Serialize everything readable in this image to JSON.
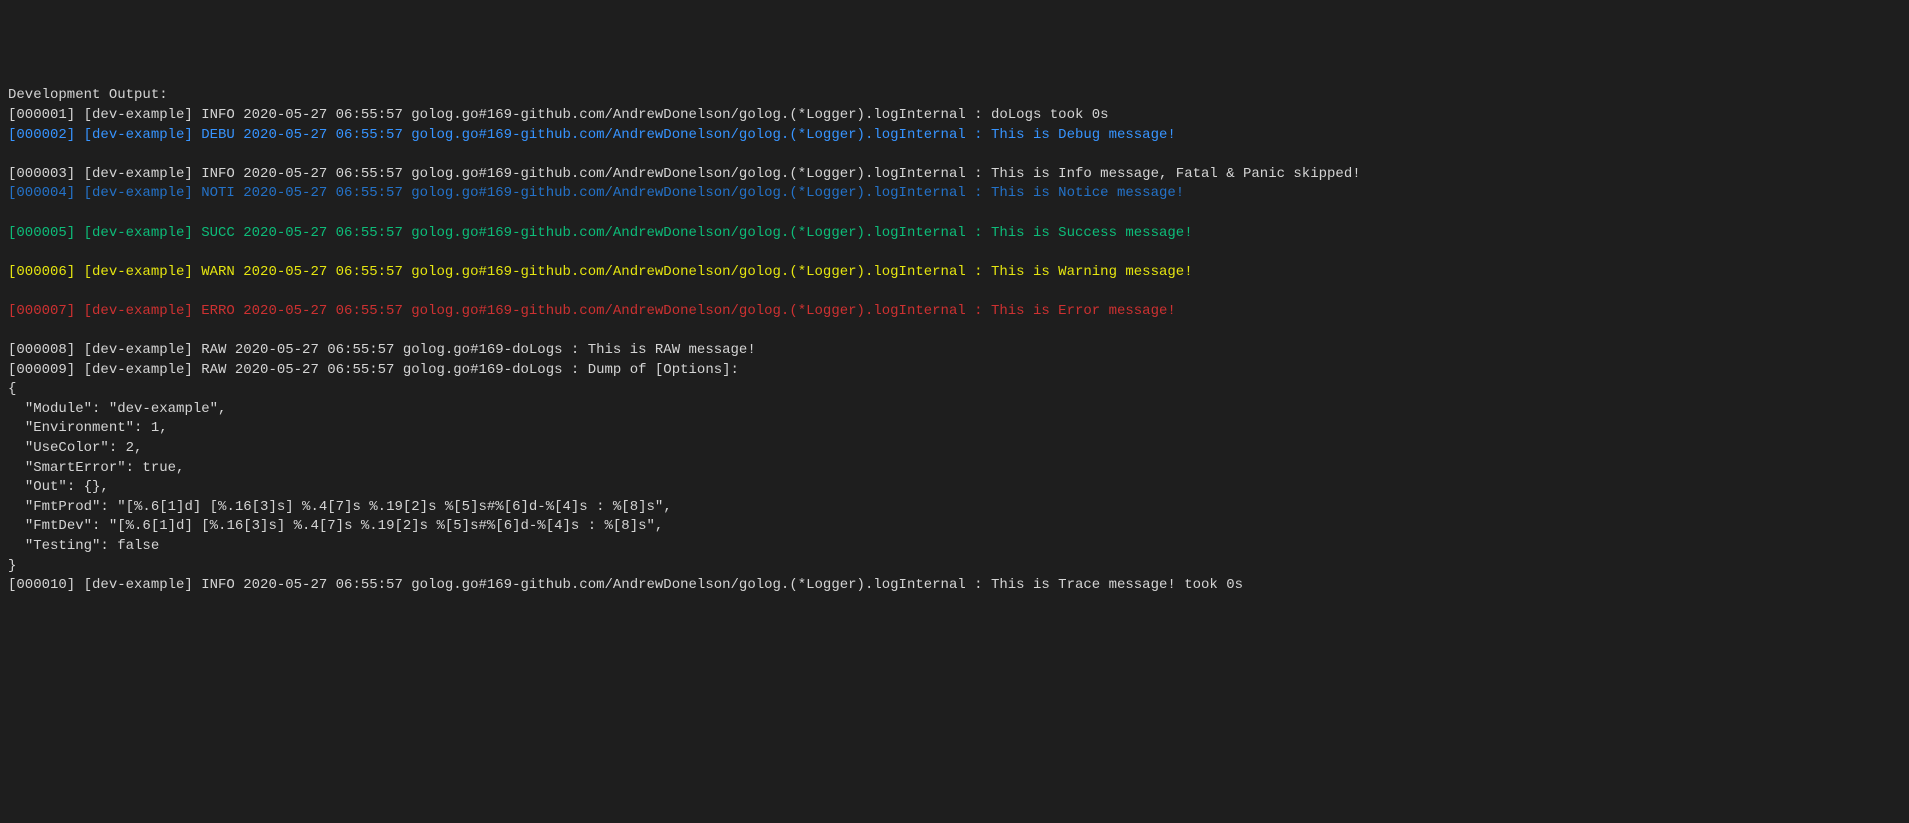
{
  "header": "Development Output:",
  "logPrefix": "golog.go#169-github.com/AndrewDonelson/golog.(*Logger).logInternal",
  "logPrefixShort": "golog.go#169-doLogs",
  "timestamp": "2020-05-27 06:55:57",
  "module": "[dev-example]",
  "entries": [
    {
      "id": "[000001]",
      "level": "INFO",
      "message": "doLogs took 0s",
      "color": "white",
      "usePrefix": "long"
    },
    {
      "id": "[000002]",
      "level": "DEBU",
      "message": "This is Debug message!",
      "color": "cyan",
      "usePrefix": "long"
    },
    {
      "blank": true
    },
    {
      "id": "[000003]",
      "level": "INFO",
      "message": "This is Info message, Fatal & Panic skipped!",
      "color": "white",
      "usePrefix": "long"
    },
    {
      "id": "[000004]",
      "level": "NOTI",
      "message": "This is Notice message!",
      "color": "blue",
      "usePrefix": "long"
    },
    {
      "blank": true
    },
    {
      "id": "[000005]",
      "level": "SUCC",
      "message": "This is Success message!",
      "color": "green",
      "usePrefix": "long"
    },
    {
      "blank": true
    },
    {
      "id": "[000006]",
      "level": "WARN",
      "message": "This is Warning message!",
      "color": "yellow",
      "usePrefix": "long"
    },
    {
      "blank": true
    },
    {
      "id": "[000007]",
      "level": "ERRO",
      "message": "This is Error message!",
      "color": "red",
      "usePrefix": "long"
    },
    {
      "blank": true
    },
    {
      "id": "[000008]",
      "level": "RAW",
      "message": "This is RAW message!",
      "color": "white",
      "usePrefix": "short"
    },
    {
      "id": "[000009]",
      "level": "RAW",
      "message": "Dump of [Options]:",
      "color": "white",
      "usePrefix": "short"
    }
  ],
  "jsonDump": [
    "{",
    "  \"Module\": \"dev-example\",",
    "  \"Environment\": 1,",
    "  \"UseColor\": 2,",
    "  \"SmartError\": true,",
    "  \"Out\": {},",
    "  \"FmtProd\": \"[%.6[1]d] [%.16[3]s] %.4[7]s %.19[2]s %[5]s#%[6]d-%[4]s : %[8]s\",",
    "  \"FmtDev\": \"[%.6[1]d] [%.16[3]s] %.4[7]s %.19[2]s %[5]s#%[6]d-%[4]s : %[8]s\",",
    "  \"Testing\": false",
    "}"
  ],
  "finalEntry": {
    "id": "[000010]",
    "level": "INFO",
    "message": "This is Trace message! took 0s",
    "color": "white",
    "usePrefix": "long"
  }
}
